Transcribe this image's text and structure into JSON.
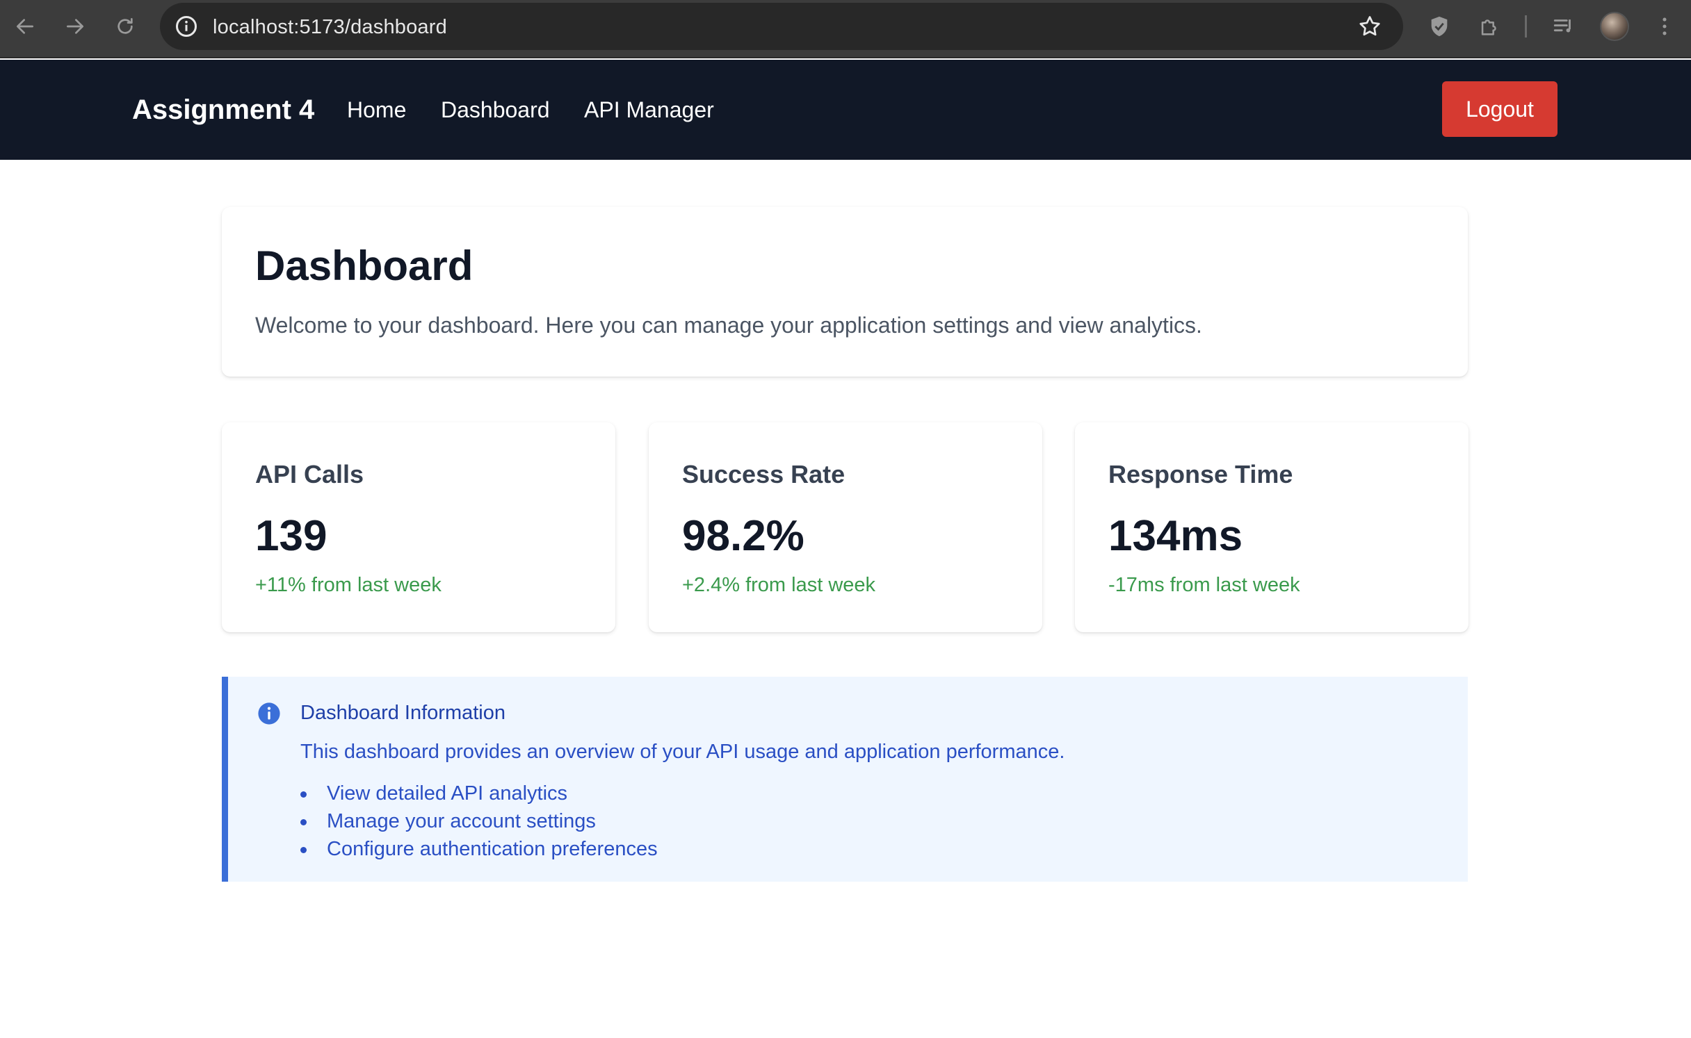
{
  "browser": {
    "url": "localhost:5173/dashboard",
    "icons": [
      "back-arrow-icon",
      "forward-arrow-icon",
      "reload-icon",
      "site-info-icon",
      "bookmark-star-icon",
      "shield-extension-icon",
      "puzzle-extensions-icon",
      "media-queue-icon",
      "profile-avatar",
      "kebab-menu-icon"
    ]
  },
  "nav": {
    "brand": "Assignment 4",
    "links": [
      "Home",
      "Dashboard",
      "API Manager"
    ],
    "logout_label": "Logout",
    "background": "#111827",
    "logout_color": "#d63a31"
  },
  "header": {
    "title": "Dashboard",
    "subtitle": "Welcome to your dashboard. Here you can manage your application settings and view analytics."
  },
  "stats": [
    {
      "label": "API Calls",
      "value": "139",
      "delta": "+11% from last week"
    },
    {
      "label": "Success Rate",
      "value": "98.2%",
      "delta": "+2.4% from last week"
    },
    {
      "label": "Response Time",
      "value": "134ms",
      "delta": "-17ms from last week"
    }
  ],
  "info": {
    "title": "Dashboard Information",
    "description": "This dashboard provides an overview of your API usage and application performance.",
    "items": [
      "View detailed API analytics",
      "Manage your account settings",
      "Configure authentication preferences"
    ],
    "accent": "#3b6fd8"
  }
}
